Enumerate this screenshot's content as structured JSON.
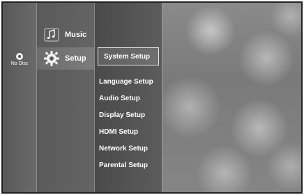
{
  "left_panel": {
    "disc_label": "No Disc",
    "disc_icon": "disc-icon"
  },
  "main_menu": {
    "items": [
      {
        "label": "Music",
        "icon": "music-note-icon"
      },
      {
        "label": "Setup",
        "icon": "gear-icon"
      }
    ]
  },
  "setup_menu": {
    "items": [
      {
        "label": "System Setup"
      },
      {
        "label": "Language Setup"
      },
      {
        "label": "Audio Setup"
      },
      {
        "label": "Display Setup"
      },
      {
        "label": "HDMI Setup"
      },
      {
        "label": "Network Setup"
      },
      {
        "label": "Parental Setup"
      }
    ]
  },
  "colors": {
    "panel": "#5f5f5f",
    "text": "#ffffff",
    "selection_border": "#e8e8e8"
  }
}
